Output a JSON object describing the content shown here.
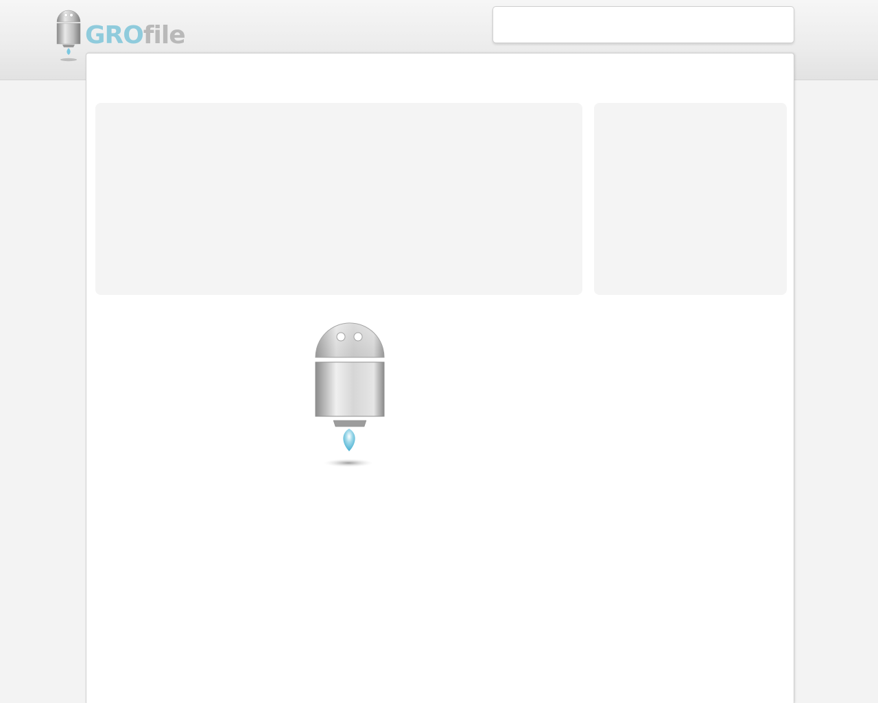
{
  "site": {
    "logo_text_primary": "GRO",
    "logo_text_secondary": "file",
    "accent_color": "#8fcbdc",
    "secondary_color": "#b9b9b9"
  },
  "search": {
    "value": "",
    "placeholder": ""
  },
  "icons": {
    "logo_mascot": "robot-rocket-icon",
    "loading_mascot": "robot-rocket-icon"
  }
}
